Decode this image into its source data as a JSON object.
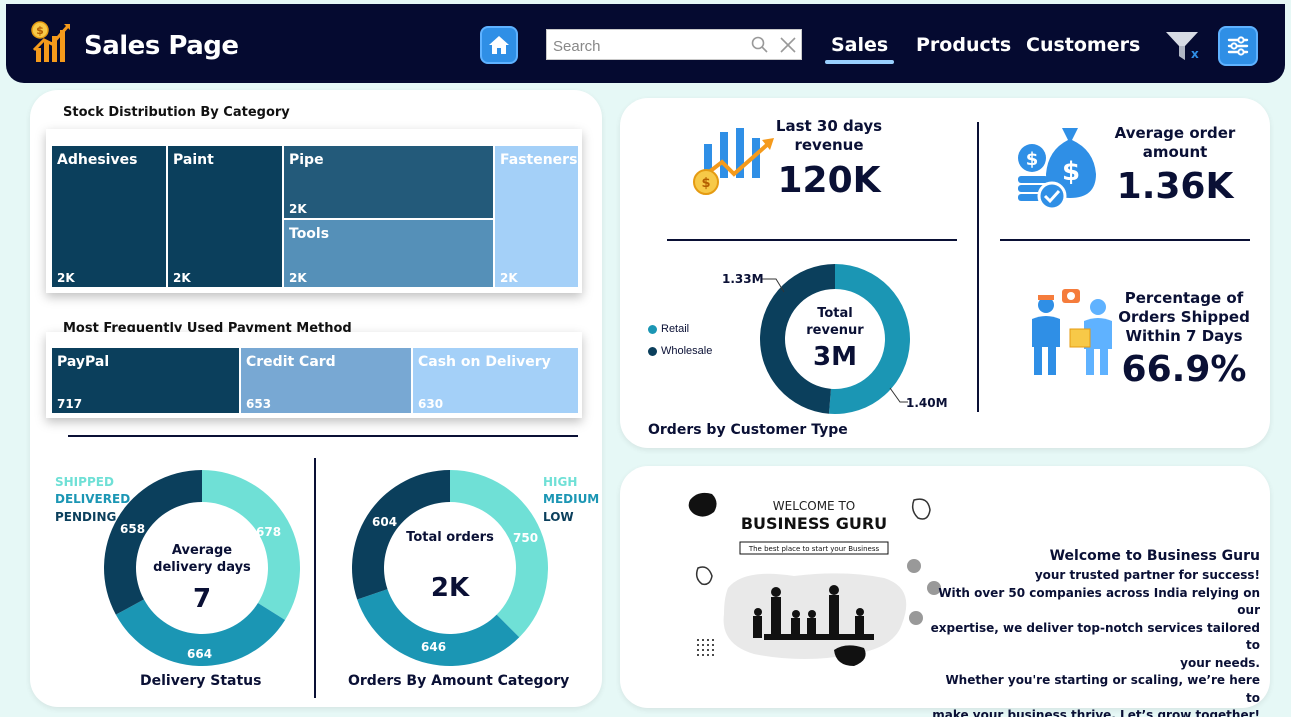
{
  "header": {
    "title": "Sales Page",
    "search_placeholder": "Search",
    "tabs": [
      {
        "label": "Sales",
        "active": true
      },
      {
        "label": "Products",
        "active": false
      },
      {
        "label": "Customers",
        "active": false
      }
    ]
  },
  "stock": {
    "title": "Stock Distribution By Category",
    "tiles": [
      {
        "name": "Adhesives",
        "value": "2K",
        "color": "#0b3f5c"
      },
      {
        "name": "Paint",
        "value": "2K",
        "color": "#0b3f5c"
      },
      {
        "name": "Pipe",
        "value": "2K",
        "color": "#235a7a"
      },
      {
        "name": "Tools",
        "value": "2K",
        "color": "#5590b8"
      },
      {
        "name": "Fasteners",
        "value": "2K",
        "color": "#a4d0f8"
      }
    ]
  },
  "payment": {
    "title": "Most Frequently Used Payment Method",
    "tiles": [
      {
        "name": "PayPal",
        "value": "717",
        "color": "#0b3f5c"
      },
      {
        "name": "Credit Card",
        "value": "653",
        "color": "#78a8d3"
      },
      {
        "name": "Cash on Delivery",
        "value": "630",
        "color": "#a4d0f8"
      }
    ]
  },
  "delivery": {
    "title": "Delivery Status",
    "center_label": "Average delivery days",
    "center_value": "7",
    "legend": [
      {
        "label": "SHIPPED",
        "color": "#6fe0d6"
      },
      {
        "label": "DELIVERED",
        "color": "#1b96b4"
      },
      {
        "label": "PENDING",
        "color": "#0b3f5c"
      }
    ],
    "values": [
      678,
      664,
      658
    ],
    "labels": [
      "678",
      "664",
      "658"
    ]
  },
  "amount_category": {
    "title": "Orders By Amount Category",
    "center_label": "Total orders",
    "center_value": "2K",
    "legend": [
      {
        "label": "HIGH",
        "color": "#6fe0d6"
      },
      {
        "label": "MEDIUM",
        "color": "#1b96b4"
      },
      {
        "label": "LOW",
        "color": "#0b3f5c"
      }
    ],
    "values": [
      750,
      646,
      604
    ],
    "labels": [
      "750",
      "646",
      "604"
    ]
  },
  "kpis": {
    "revenue_label": "Last 30 days revenue",
    "revenue_value": "120K",
    "avg_order_label": "Average order amount",
    "avg_order_value": "1.36K",
    "shipped_label": "Percentage of Orders Shipped Within 7 Days",
    "shipped_value": "66.9%"
  },
  "customer_type": {
    "title": "Orders by Customer Type",
    "center_label": "Total revenur",
    "center_value": "3M",
    "legend": [
      {
        "label": "Retail",
        "color": "#1b96b4"
      },
      {
        "label": "Wholesale",
        "color": "#0b3f5c"
      }
    ],
    "values": [
      1.4,
      1.33
    ],
    "labels": [
      "1.40M",
      "1.33M"
    ]
  },
  "welcome": {
    "image_heading": "WELCOME TO",
    "image_brand": "BUSINESS GURU",
    "image_tagline": "The best place to start your Business",
    "title": "Welcome to Business Guru",
    "body": "your trusted partner for success!\nWith over 50 companies across India relying on our expertise, we deliver top-notch services tailored to your needs.\nWhether you're starting or scaling, we’re here to make your business thrive. Let’s grow together!",
    "lines": [
      "your trusted partner for success! ",
      "With over 50 companies across India relying on our",
      "expertise, we deliver top-notch services tailored to",
      "your needs. ",
      "Whether you're starting or scaling, we’re here to",
      "make your business thrive. Let’s grow together!"
    ]
  },
  "chart_data": [
    {
      "type": "treemap",
      "title": "Stock Distribution By Category",
      "categories": [
        "Adhesives",
        "Paint",
        "Pipe",
        "Tools",
        "Fasteners"
      ],
      "value_labels": [
        "2K",
        "2K",
        "2K",
        "2K",
        "2K"
      ]
    },
    {
      "type": "treemap",
      "title": "Most Frequently Used Payment Method",
      "categories": [
        "PayPal",
        "Credit Card",
        "Cash on Delivery"
      ],
      "values": [
        717,
        653,
        630
      ]
    },
    {
      "type": "pie",
      "title": "Delivery Status",
      "categories": [
        "SHIPPED",
        "DELIVERED",
        "PENDING"
      ],
      "values": [
        678,
        664,
        658
      ]
    },
    {
      "type": "pie",
      "title": "Orders By Amount Category",
      "categories": [
        "HIGH",
        "MEDIUM",
        "LOW"
      ],
      "values": [
        750,
        646,
        604
      ]
    },
    {
      "type": "pie",
      "title": "Orders by Customer Type",
      "categories": [
        "Retail",
        "Wholesale"
      ],
      "values": [
        1.4,
        1.33
      ],
      "value_labels": [
        "1.40M",
        "1.33M"
      ]
    }
  ]
}
